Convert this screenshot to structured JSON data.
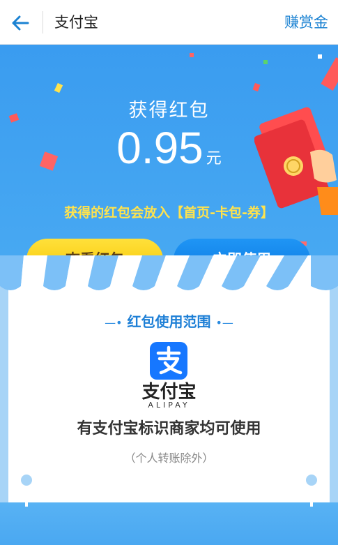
{
  "navbar": {
    "back_icon": "arrow-left-icon",
    "title": "支付宝",
    "action_label": "赚赏金"
  },
  "hero": {
    "title": "获得红包",
    "amount": "0.95",
    "unit": "元",
    "note": "获得的红包会放入【首页-卡包-券】"
  },
  "buttons": {
    "view_label": "查看红包",
    "use_label": "立即使用"
  },
  "scope": {
    "title": "红包使用范围",
    "logo_icon": "alipay-logo-icon",
    "brand_name": "支付宝",
    "brand_name_en": "ALIPAY",
    "description": "有支付宝标识商家均可使用",
    "exception": "（个人转账除外）"
  },
  "colors": {
    "nav_action": "#1b82d2",
    "hero_blue": "#3a9cf0",
    "note_yellow": "#ffe34d",
    "view_button": "#f7c600",
    "use_button": "#0a78e0",
    "alipay_blue": "#1677ff"
  }
}
